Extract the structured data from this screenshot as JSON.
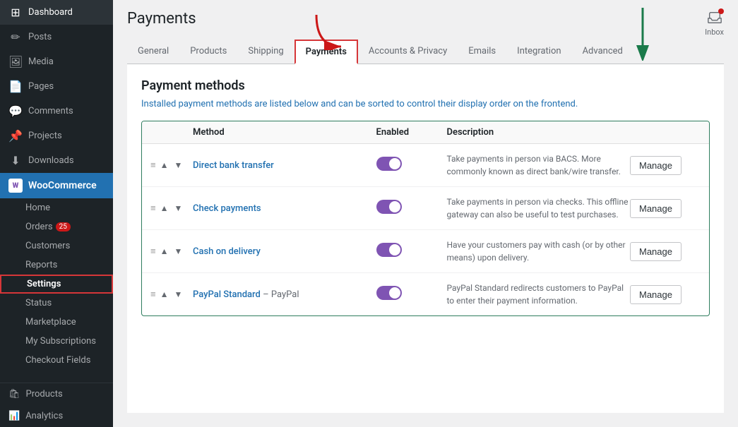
{
  "sidebar": {
    "top_items": [
      {
        "id": "dashboard",
        "label": "Dashboard",
        "icon": "⊞"
      },
      {
        "id": "posts",
        "label": "Posts",
        "icon": "✎"
      },
      {
        "id": "media",
        "label": "Media",
        "icon": "🖼"
      },
      {
        "id": "pages",
        "label": "Pages",
        "icon": "📄"
      },
      {
        "id": "comments",
        "label": "Comments",
        "icon": "💬"
      },
      {
        "id": "projects",
        "label": "Projects",
        "icon": "📌"
      },
      {
        "id": "downloads",
        "label": "Downloads",
        "icon": "⬇"
      }
    ],
    "woocommerce": {
      "label": "WooCommerce",
      "icon": "W",
      "sub_items": [
        {
          "id": "home",
          "label": "Home",
          "active": false
        },
        {
          "id": "orders",
          "label": "Orders",
          "badge": "25",
          "active": false
        },
        {
          "id": "customers",
          "label": "Customers",
          "active": false
        },
        {
          "id": "reports",
          "label": "Reports",
          "active": false
        },
        {
          "id": "settings",
          "label": "Settings",
          "active": true
        },
        {
          "id": "status",
          "label": "Status",
          "active": false
        },
        {
          "id": "marketplace",
          "label": "Marketplace",
          "active": false
        },
        {
          "id": "my_subscriptions",
          "label": "My Subscriptions",
          "active": false
        },
        {
          "id": "checkout_fields",
          "label": "Checkout Fields",
          "active": false
        }
      ]
    },
    "bottom_items": [
      {
        "id": "products",
        "label": "Products",
        "icon": "🛍"
      },
      {
        "id": "analytics",
        "label": "Analytics",
        "icon": "📊"
      }
    ]
  },
  "header": {
    "page_title": "Payments",
    "inbox_label": "Inbox"
  },
  "tabs": [
    {
      "id": "general",
      "label": "General",
      "active": false
    },
    {
      "id": "products",
      "label": "Products",
      "active": false
    },
    {
      "id": "shipping",
      "label": "Shipping",
      "active": false
    },
    {
      "id": "payments",
      "label": "Payments",
      "active": true
    },
    {
      "id": "accounts_privacy",
      "label": "Accounts & Privacy",
      "active": false
    },
    {
      "id": "emails",
      "label": "Emails",
      "active": false
    },
    {
      "id": "integration",
      "label": "Integration",
      "active": false
    },
    {
      "id": "advanced",
      "label": "Advanced",
      "active": false
    }
  ],
  "content": {
    "section_title": "Payment methods",
    "section_desc": "Installed payment methods are listed below and can be sorted to control their display order on the frontend.",
    "table_headers": {
      "method": "Method",
      "enabled": "Enabled",
      "description": "Description"
    },
    "payment_methods": [
      {
        "id": "direct_bank",
        "name": "Direct bank transfer",
        "enabled": true,
        "description": "Take payments in person via BACS. More commonly known as direct bank/wire transfer.",
        "manage_label": "Manage"
      },
      {
        "id": "check_payments",
        "name": "Check payments",
        "enabled": true,
        "description": "Take payments in person via checks. This offline gateway can also be useful to test purchases.",
        "manage_label": "Manage"
      },
      {
        "id": "cash_on_delivery",
        "name": "Cash on delivery",
        "enabled": true,
        "description": "Have your customers pay with cash (or by other means) upon delivery.",
        "manage_label": "Manage"
      },
      {
        "id": "paypal",
        "name": "PayPal Standard",
        "name_suffix": "– PayPal",
        "enabled": true,
        "description": "PayPal Standard redirects customers to PayPal to enter their payment information.",
        "manage_label": "Manage"
      }
    ]
  }
}
